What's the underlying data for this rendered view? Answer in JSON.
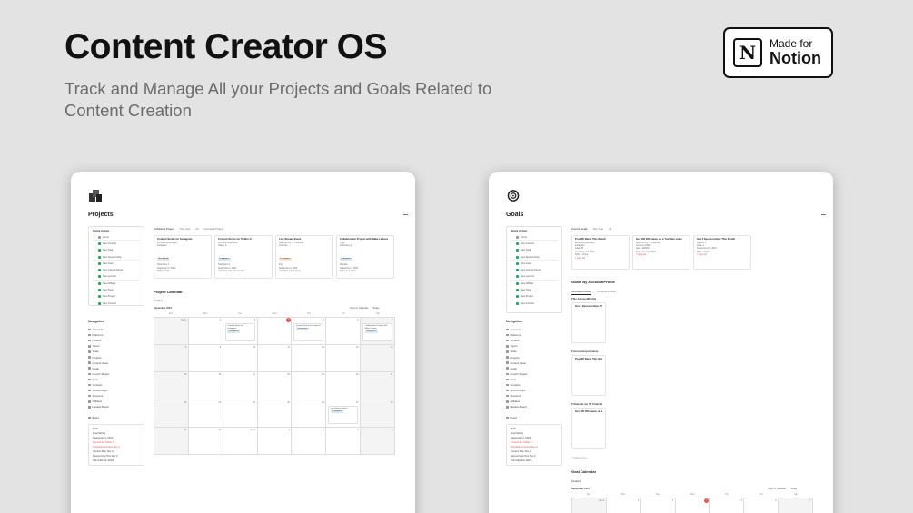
{
  "hero": {
    "title": "Content Creator OS",
    "subtitle": "Track and Manage All your Projects and Goals Related to Content Creation"
  },
  "badge": {
    "logo_letter": "N",
    "line1": "Made for",
    "line2": "Notion"
  },
  "colors": {
    "background": "#e3e3e3",
    "accent_green": "#2f9e6c",
    "today_red": "#e55353"
  },
  "projects_panel": {
    "icon": "projects-stack-icon",
    "title": "Projects",
    "quick_action": {
      "title": "Quick Action",
      "items": [
        "Home",
        "New Content",
        "New Task",
        "New Sponsorship",
        "New Goal",
        "New Growth Target",
        "New sponsor",
        "New Affiliate",
        "New Topic",
        "New Project",
        "New Contact"
      ]
    },
    "navigation": {
      "title": "Navigation",
      "items": [
        "Accounts",
        "Platforms",
        "Content",
        "Topics",
        "Tasks",
        "Projects",
        "Content Ideas",
        "Goals",
        "Growth Targets",
        "Tools",
        "Contacts",
        "Sponsorships",
        "Sponsors",
        "Affiliates",
        "Hardest Board"
      ]
    },
    "extra_nav": [
      "Board"
    ],
    "notes": {
      "title": "Hub",
      "items": [
        "Goal Setting",
        "September 2, 2024",
        "Content for Twitter X",
        "Scheduled Content Due 3",
        "Content Plan Nov 3",
        "Sponsorship This Nov 3",
        "Tall Collection 06/04"
      ]
    },
    "tabs": [
      "Unfinished Project",
      "This Year",
      "All",
      "Canceled Project"
    ],
    "cards": [
      {
        "title": "Content Series for Instagram",
        "lines": [
          "Accountreyourname",
          "Instagram",
          "Task Done 1",
          "September 2, 2024",
          "Status: Todo"
        ],
        "tag": "Not started",
        "tag_color": "#e6e6e6"
      },
      {
        "title": "Content Series for Twitter-X",
        "lines": [
          "Accountreyourname",
          "Twitter-X",
          "Task Done 1",
          "September 2, 2024",
          "Complete only this one item"
        ],
        "tag": "In progress",
        "tag_color": "#d8e8f6"
      },
      {
        "title": "Live Stream Event",
        "lines": [
          "Share at my YT Channel",
          "YouTube",
          "Info",
          "September 2, 2024",
          "Complete only 4 items"
        ],
        "tag": "In progress",
        "tag_color": "#fbe3c9"
      },
      {
        "title": "Collaboration Project with Make Lettuce",
        "lines": [
          "Yoga",
          "Task Done 1",
          "Website",
          "September 2, 2024",
          "Done: 1 of 1 item"
        ],
        "tag": "In progress",
        "tag_color": "#d8e8f6"
      }
    ],
    "calendar": {
      "title": "Project Calendar",
      "view": "Deadline",
      "month": "September 2024",
      "open_label": "Open in Calendar",
      "today_label": "Today",
      "weekdays": [
        "Sun",
        "Mon",
        "Tue",
        "Wed",
        "Thu",
        "Fri",
        "Sat"
      ],
      "weeks": [
        [
          "Sep 1",
          "2",
          "3",
          "4",
          "5",
          "6",
          "7"
        ],
        [
          "8",
          "9",
          "10",
          "11",
          "12",
          "13",
          "14"
        ],
        [
          "15",
          "16",
          "17",
          "18",
          "19",
          "20",
          "21"
        ],
        [
          "22",
          "23",
          "24",
          "25",
          "26",
          "27",
          "28"
        ],
        [
          "29",
          "30",
          "Oct 1",
          "2",
          "3",
          "4",
          "5"
        ]
      ],
      "today_cell": "4",
      "events": [
        {
          "week": 0,
          "day": 2,
          "title": "Content Series for Instagram",
          "tag": "In progress"
        },
        {
          "week": 0,
          "day": 4,
          "title": "Content Series for Twitter-X",
          "tag": "In progress"
        },
        {
          "week": 0,
          "day": 6,
          "title": "Collaboration Project with Make Lettuce",
          "tag": "In progress"
        },
        {
          "week": 3,
          "day": 5,
          "title": "Live Stream Event",
          "tag": "In progress"
        }
      ]
    }
  },
  "goals_panel": {
    "icon": "target-icon",
    "title": "Goals",
    "tabs": [
      "Current Goals",
      "This Year",
      "All"
    ],
    "cards": [
      {
        "title": "Post 35 Reels This Month",
        "lines": [
          "Accountreyourname",
          "Instagram",
          "Goal: 35",
          "September 02, 2024",
          "50% — Done"
        ],
        "due": "7 days left"
      },
      {
        "title": "Get 100 000 views on a YouTube video",
        "lines": [
          "Share at my YT Channel",
          "Current: 12000",
          "Goal: 100000",
          "September 02, 2024"
        ],
        "due": "7 days left"
      },
      {
        "title": "Get 4 Sponsorships This Month",
        "lines": [
          "Current: 1",
          "Goal: 4",
          "September 02, 2024",
          "25% — Done"
        ],
        "due": "7 days left"
      }
    ],
    "by_account": {
      "title": "Goals By Account/Profile",
      "tabs": [
        "Incomplete Goals",
        "Completed Goals"
      ],
      "groups": [
        {
          "name": "No Account/Profile",
          "card": "Get 4 Sponsorships This Month"
        },
        {
          "name": "Accountreyourname",
          "card": "Post 35 Reels This Month"
        },
        {
          "name": "Share at my YT Channel",
          "card": "Get 100 000 views on a YouTube video"
        }
      ],
      "hidden": "1 hidden group"
    },
    "calendar": {
      "title": "Goal Calendar",
      "view": "Deadline",
      "month": "September 2024",
      "open_label": "Open in Calendar",
      "today_label": "Today",
      "weekdays": [
        "Sun",
        "Mon",
        "Tue",
        "Wed",
        "Thu",
        "Fri",
        "Sat"
      ],
      "week": [
        "Sep 1",
        "2",
        "3",
        "4",
        "5",
        "6",
        "7"
      ],
      "today_cell": "4"
    }
  }
}
